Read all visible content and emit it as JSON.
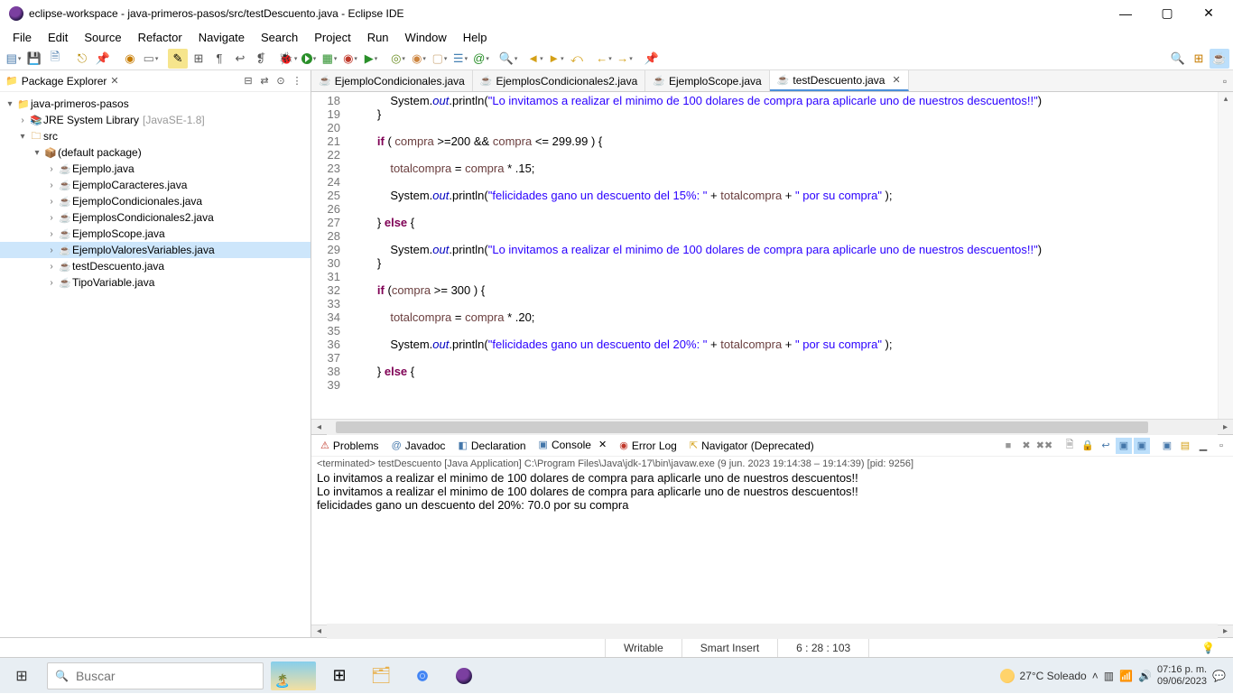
{
  "window": {
    "title": "eclipse-workspace - java-primeros-pasos/src/testDescuento.java - Eclipse IDE"
  },
  "menu": [
    "File",
    "Edit",
    "Source",
    "Refactor",
    "Navigate",
    "Search",
    "Project",
    "Run",
    "Window",
    "Help"
  ],
  "sidebar": {
    "title": "Package Explorer",
    "project": "java-primeros-pasos",
    "jre": "JRE System Library",
    "jre_env": "[JavaSE-1.8]",
    "src": "src",
    "pkg": "(default package)",
    "files": [
      "Ejemplo.java",
      "EjemploCaracteres.java",
      "EjemploCondicionales.java",
      "EjemplosCondicionales2.java",
      "EjemploScope.java",
      "EjemploValoresVariables.java",
      "testDescuento.java",
      "TipoVariable.java"
    ],
    "selected_index": 5
  },
  "editor": {
    "tabs": [
      "EjemploCondicionales.java",
      "EjemplosCondicionales2.java",
      "EjemploScope.java",
      "testDescuento.java"
    ],
    "active_index": 3,
    "line_start": 18,
    "line_end": 39
  },
  "bottom_tabs": {
    "problems": "Problems",
    "javadoc": "Javadoc",
    "declaration": "Declaration",
    "console": "Console",
    "errorlog": "Error Log",
    "navigator": "Navigator (Deprecated)"
  },
  "console": {
    "header": "<terminated> testDescuento [Java Application] C:\\Program Files\\Java\\jdk-17\\bin\\javaw.exe (9 jun. 2023 19:14:38 – 19:14:39) [pid: 9256]",
    "lines": [
      "Lo invitamos a realizar el minimo de 100 dolares de compra para aplicarle uno de nuestros descuentos!!",
      "Lo invitamos a realizar el minimo de 100 dolares de compra para aplicarle uno de nuestros descuentos!!",
      "felicidades gano un descuento del 20%: 70.0 por su compra"
    ]
  },
  "status": {
    "writable": "Writable",
    "insert": "Smart Insert",
    "cursor": "6 : 28 : 103"
  },
  "taskbar": {
    "search_placeholder": "Buscar",
    "weather": "27°C  Soleado",
    "time": "07:16 p. m.",
    "date": "09/06/2023"
  }
}
